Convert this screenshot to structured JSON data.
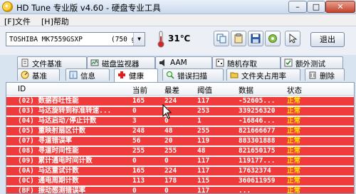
{
  "window": {
    "title": "HD Tune 专业版 v4.60 - 硬盘专业工具",
    "minimize": "–",
    "maximize": "□",
    "close": "✕"
  },
  "menu": [
    {
      "label": "[F]文件"
    },
    {
      "label": "[H]帮助"
    }
  ],
  "toolbar": {
    "drive": "TOSHIBA MK7559GSXP       (750 gB)",
    "temperature": "31℃",
    "exit_label": "退出"
  },
  "tabs_top": [
    {
      "label": "文件基准",
      "icon": "file-benchmark-icon"
    },
    {
      "label": "磁盘监视器",
      "icon": "disk-monitor-icon"
    },
    {
      "label": "AAM",
      "icon": "speaker-icon"
    },
    {
      "label": "随机存取",
      "icon": "random-access-icon"
    },
    {
      "label": "额外测试",
      "icon": "extra-tests-icon"
    }
  ],
  "tabs_bottom": [
    {
      "label": "基准",
      "icon": "benchmark-icon"
    },
    {
      "label": "信息",
      "icon": "info-icon"
    },
    {
      "label": "健康",
      "icon": "health-icon",
      "active": true
    },
    {
      "label": "错误扫描",
      "icon": "error-scan-icon"
    },
    {
      "label": "文件夹占用率",
      "icon": "folder-usage-icon"
    },
    {
      "label": "删除",
      "icon": "erase-icon"
    }
  ],
  "table": {
    "headers": [
      "ID",
      "当前",
      "最差",
      "阈值",
      "数据",
      "状态"
    ],
    "rows": [
      {
        "id": "(02) 数据吞吐性能",
        "cur": "165",
        "worst": "224",
        "thr": "117",
        "data": "-52605...",
        "status": "正常"
      },
      {
        "id": "(03) 马达旋转到标准转速...",
        "cur": "0",
        "worst": "0",
        "thr": "253",
        "data": "339256320",
        "status": "正常"
      },
      {
        "id": "(04) 马达启动/停止计数",
        "cur": "3",
        "worst": "0",
        "thr": "1",
        "data": "-16846...",
        "status": "正常"
      },
      {
        "id": "(05) 重映射扇区计数",
        "cur": "248",
        "worst": "48",
        "thr": "255",
        "data": "821666677",
        "status": "正常"
      },
      {
        "id": "(07) 寻道错误率",
        "cur": "56",
        "worst": "20",
        "thr": "119",
        "data": "883301888",
        "status": "正常"
      },
      {
        "id": "(08) 寻道时间性能",
        "cur": "255",
        "worst": "255",
        "thr": "48",
        "data": "821650175",
        "status": "正常"
      },
      {
        "id": "(09) 累计通电时间计数",
        "cur": "0",
        "worst": "0",
        "thr": "117",
        "data": "119177...",
        "status": "正常"
      },
      {
        "id": "(0A) 马达重试计数",
        "cur": "165",
        "worst": "224",
        "thr": "117",
        "data": "17632374",
        "status": "正常"
      },
      {
        "id": "(0C) 通电周期计数",
        "cur": "113",
        "worst": "178",
        "thr": "115",
        "data": "360611959",
        "status": "正常"
      },
      {
        "id": "(BF) 振动感测错误率",
        "cur": "0",
        "worst": "0",
        "thr": "117",
        "data": "...",
        "status": "正常"
      }
    ]
  },
  "colors": {
    "row_error": "#ef3b3b",
    "row_text": "#ffffff",
    "status_text": "#ffe400"
  }
}
